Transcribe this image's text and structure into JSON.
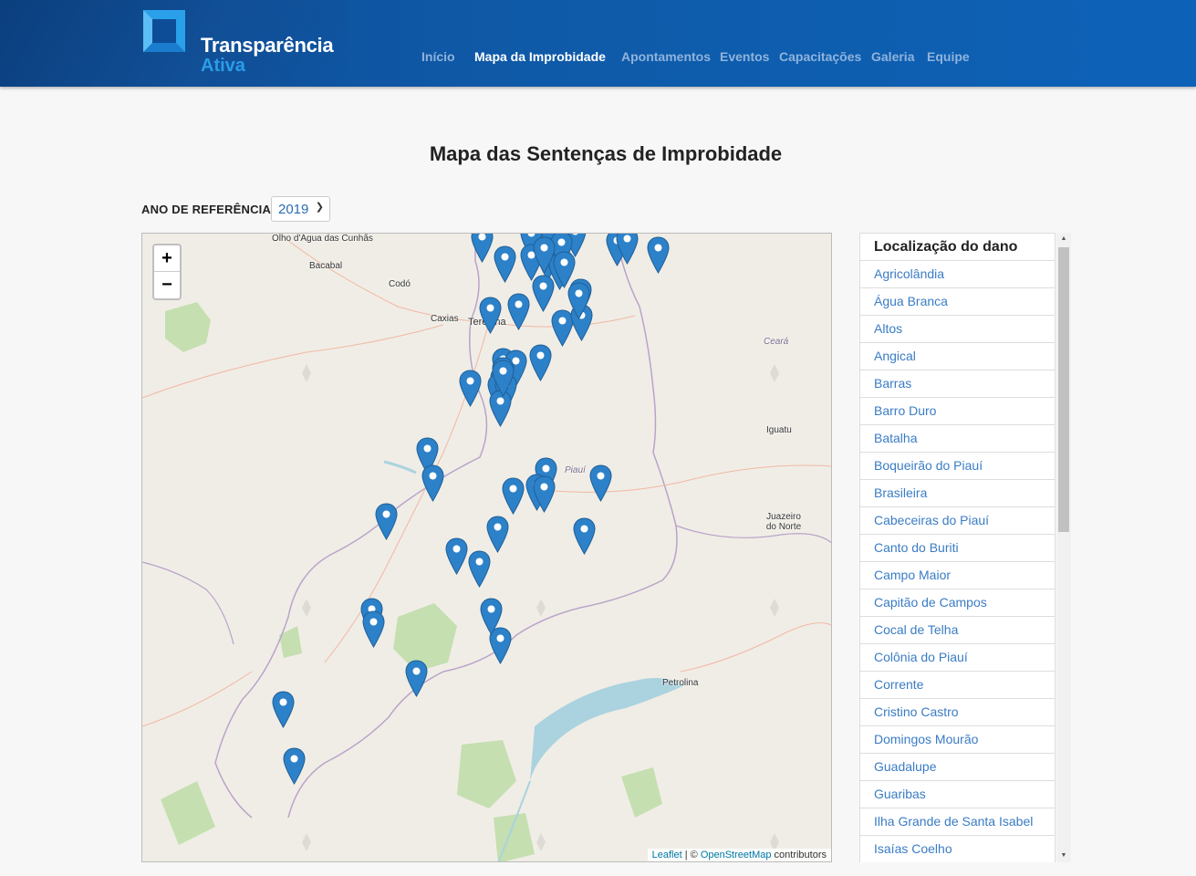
{
  "brand": {
    "line1": "Transparência",
    "line2": "Ativa"
  },
  "nav": [
    {
      "label": "Início",
      "active": false
    },
    {
      "label": "Mapa da Improbidade",
      "active": true
    },
    {
      "label": "Apontamentos",
      "active": false
    },
    {
      "label": "Eventos",
      "active": false
    },
    {
      "label": "Capacitações",
      "active": false
    },
    {
      "label": "Galeria",
      "active": false
    },
    {
      "label": "Equipe",
      "active": false
    }
  ],
  "page_title": "Mapa das Sentenças de Improbidade",
  "filter": {
    "label": "ANO DE REFERÊNCIA:",
    "selected_year": "2019"
  },
  "map": {
    "zoom_in": "+",
    "zoom_out": "−",
    "attribution": {
      "leaflet": "Leaflet",
      "sep": " | © ",
      "osm": "OpenStreetMap",
      "suffix": " contributors"
    },
    "place_labels": [
      "Olho d'Água das Cunhãs",
      "Bacabal",
      "Codó",
      "Caxias",
      "Teresina",
      "Ceará",
      "Iguatu",
      "Piauí",
      "Juazeiro do Norte",
      "Petrolina"
    ],
    "marker_count": 52,
    "marker_color": "#2c81c9"
  },
  "panel": {
    "title": "Localização do dano",
    "items": [
      "Agricolândia",
      "Água Branca",
      "Altos",
      "Angical",
      "Barras",
      "Barro Duro",
      "Batalha",
      "Boqueirão do Piauí",
      "Brasileira",
      "Cabeceiras do Piauí",
      "Canto do Buriti",
      "Campo Maior",
      "Capitão de Campos",
      "Cocal de Telha",
      "Colônia do Piauí",
      "Corrente",
      "Cristino Castro",
      "Domingos Mourão",
      "Guadalupe",
      "Guaribas",
      "Ilha Grande de Santa Isabel",
      "Isaías Coelho"
    ]
  }
}
